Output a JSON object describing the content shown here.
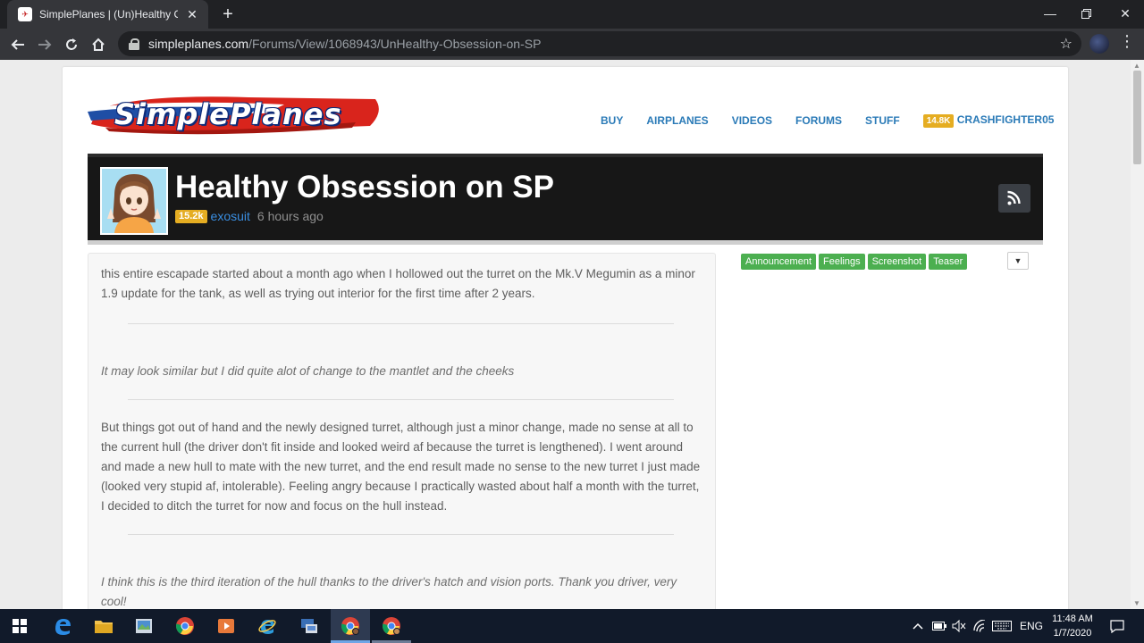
{
  "browser": {
    "tab_title": "SimplePlanes | (Un)Healthy Obsession on SP",
    "url_host": "simpleplanes.com",
    "url_path": "/Forums/View/1068943/UnHealthy-Obsession-on-SP"
  },
  "site": {
    "logo_text": "SimplePlanes",
    "nav": [
      "BUY",
      "AIRPLANES",
      "VIDEOS",
      "FORUMS",
      "STUFF"
    ],
    "user_points": "14.8K",
    "username": "CRASHFIGHTER05"
  },
  "post": {
    "title": "Healthy Obsession on SP",
    "author_points": "15.2k",
    "author": "exosuit",
    "time": "6 hours ago",
    "paragraphs": [
      "this entire escapade started about a month ago when I hollowed out the turret on the Mk.V Megumin as a minor 1.9 update for the tank, as well as trying out interior for the first time after 2 years.",
      "It may look similar but I did quite alot of change to the mantlet and the cheeks",
      "But things got out of hand and the newly designed turret, although just a minor change, made no sense at all to the current hull (the driver don't fit inside and looked weird af because the turret is lengthened). I went around and made a new hull to mate with the new turret, and the end result made no sense to the new turret I just made (looked very stupid af, intolerable). Feeling angry because I practically wasted about half a month with the turret, I decided to ditch the turret for now and focus on the hull instead.",
      "I think this is the third iteration of the hull thanks to the driver's hatch and vision ports. Thank you driver, very cool!"
    ],
    "tags": [
      "Announcement",
      "Feelings",
      "Screenshot",
      "Teaser"
    ]
  },
  "taskbar": {
    "lang": "ENG",
    "time": "11:48 AM",
    "date": "1/7/2020"
  },
  "colors": {
    "nav_link": "#2a7ab7",
    "badge": "#e5ad22",
    "tag": "#4caf50",
    "header_band": "#171717"
  }
}
